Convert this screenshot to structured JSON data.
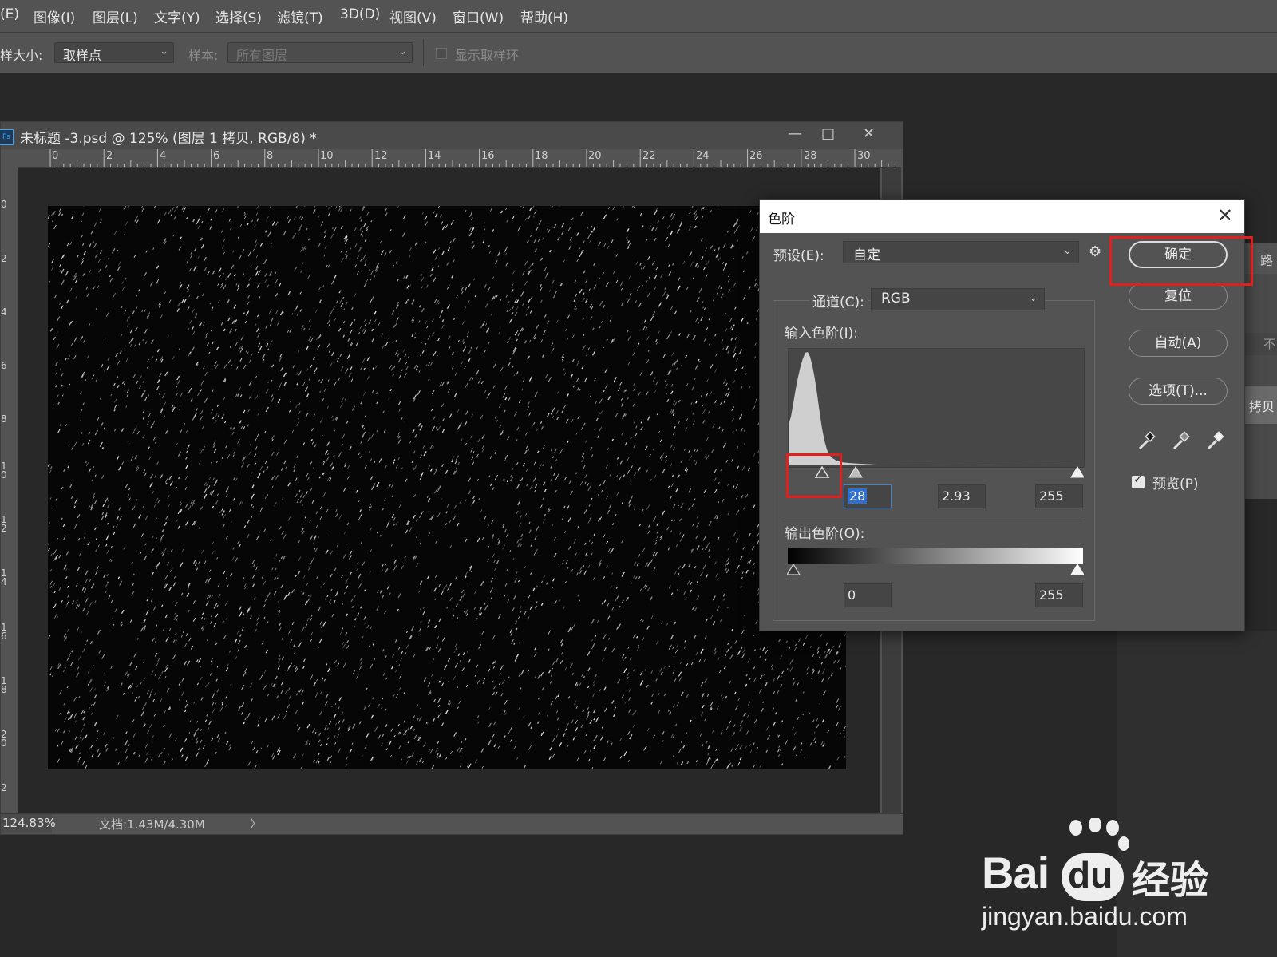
{
  "menubar": {
    "items": [
      "(E)",
      "图像(I)",
      "图层(L)",
      "文字(Y)",
      "选择(S)",
      "滤镜(T)",
      "3D(D)",
      "视图(V)",
      "窗口(W)",
      "帮助(H)"
    ]
  },
  "options": {
    "sample_size_label": "样大小:",
    "sample_size_value": "取样点",
    "sample_label": "样本:",
    "sample_value": "所有图层",
    "show_ring_label": "显示取样环"
  },
  "document": {
    "title": "未标题 -3.psd @ 125% (图层 1 拷贝, RGB/8) *",
    "ps_badge": "Ps",
    "ruler_top": [
      "0",
      "2",
      "4",
      "6",
      "8",
      "10",
      "12",
      "14",
      "16",
      "18",
      "20",
      "22",
      "24",
      "26",
      "28",
      "30"
    ],
    "ruler_left": [
      "0",
      "2",
      "4",
      "6",
      "8",
      "1\n0",
      "1\n2",
      "1\n4",
      "1\n6",
      "1\n8",
      "2\n0",
      "2"
    ],
    "zoom": "124.83%",
    "doc_size": "文档:1.43M/4.30M",
    "arrow": "〉",
    "win_minimize": "—",
    "win_restore": "□",
    "win_close": "✕"
  },
  "right_panel": {
    "tab_glyph": "路",
    "text_not": "不",
    "layer_label": "拷贝"
  },
  "levels_dialog": {
    "title": "色阶",
    "close": "✕",
    "preset_label": "预设(E):",
    "preset_value": "自定",
    "gear": "⚙",
    "channel_label": "通道(C):",
    "channel_value": "RGB",
    "input_levels_label": "输入色阶(I):",
    "input_black": "28",
    "input_gamma": "2.93",
    "input_white": "255",
    "output_levels_label": "输出色阶(O):",
    "output_black": "0",
    "output_white": "255",
    "buttons": {
      "ok": "确定",
      "reset": "复位",
      "auto": "自动(A)",
      "options": "选项(T)..."
    },
    "preview_label": "预览(P)",
    "preview_checked": true
  },
  "watermark": {
    "brand_a": "Bai",
    "brand_b": "du",
    "brand_c": "经验",
    "url": "jingyan.baidu.com"
  },
  "colors": {
    "highlight": "#e0201e",
    "panel": "#535353",
    "workspace": "#282828"
  }
}
